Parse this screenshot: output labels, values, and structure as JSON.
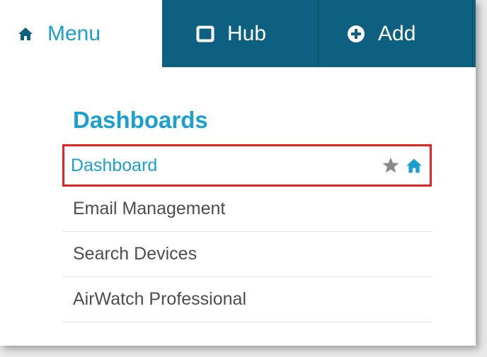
{
  "nav": {
    "tabs": [
      {
        "label": "Menu",
        "icon": "home-icon",
        "active": true
      },
      {
        "label": "Hub",
        "icon": "square-icon",
        "active": false
      },
      {
        "label": "Add",
        "icon": "plus-circle-icon",
        "active": false
      }
    ]
  },
  "menu": {
    "section_title": "Dashboards",
    "items": [
      {
        "label": "Dashboard",
        "selected": true,
        "actions": [
          "star-icon",
          "home-icon"
        ]
      },
      {
        "label": "Email Management",
        "selected": false
      },
      {
        "label": "Search Devices",
        "selected": false
      },
      {
        "label": "AirWatch Professional",
        "selected": false
      }
    ]
  },
  "colors": {
    "nav_background": "#0d607f",
    "accent": "#1a9fd1",
    "highlight_border": "#e52421",
    "text": "#4d4d4d",
    "star": "#8a8a8a"
  }
}
